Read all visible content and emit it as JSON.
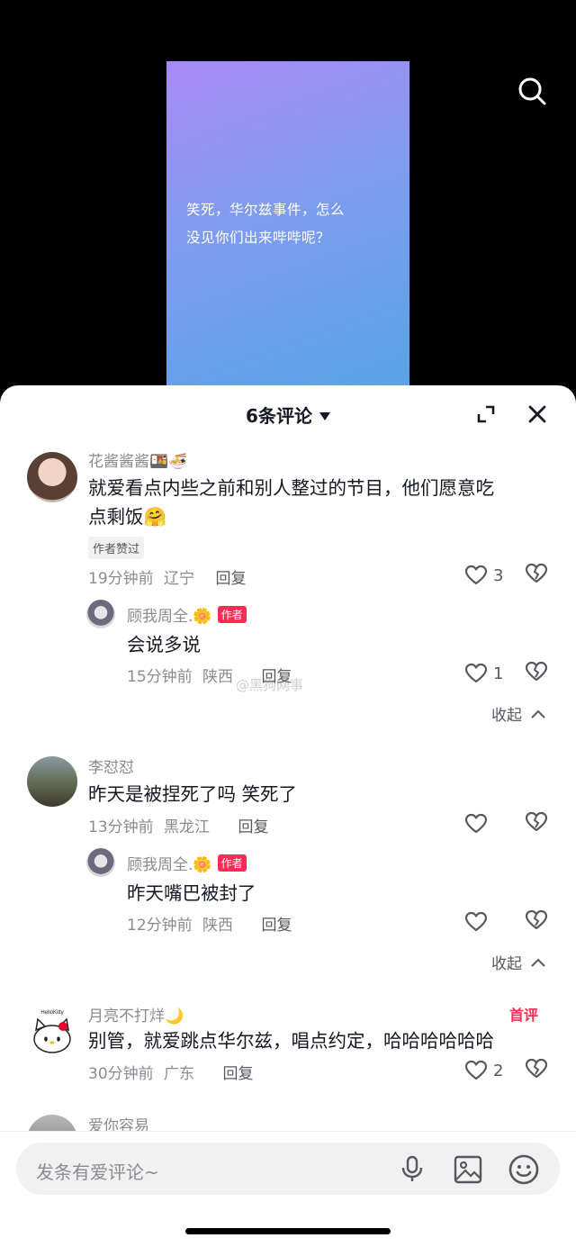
{
  "video": {
    "caption_line1": "笑死，华尔兹事件，怎么",
    "caption_line2": "没见你们出来哔哔呢？"
  },
  "icons": {
    "search": "search-icon",
    "expand": "expand-icon",
    "close": "close-icon",
    "like": "heart-icon",
    "dislike": "broken-heart-icon",
    "mic": "microphone-icon",
    "image": "image-icon",
    "emoji": "emoji-icon"
  },
  "header": {
    "count_label": "6条评论"
  },
  "comments": [
    {
      "name": "花酱酱酱🍱🍜",
      "text_line1": "就爱看点内些之前和别人整过的节目，他们愿意吃",
      "text_line2": "点剩饭🤗",
      "badge": "作者赞过",
      "time": "19分钟前",
      "location": "辽宁",
      "reply": "回复",
      "likes": "3",
      "replies": [
        {
          "name": "顾我周全.🌼",
          "author_tag": "作者",
          "text": "会说多说",
          "time": "15分钟前",
          "location": "陕西",
          "reply": "回复",
          "likes": "1"
        }
      ],
      "collapse": "收起"
    },
    {
      "name": "李怼怼",
      "text_line1": "昨天是被捏死了吗 笑死了",
      "time": "13分钟前",
      "location": "黑龙江",
      "reply": "回复",
      "likes": "",
      "replies": [
        {
          "name": "顾我周全.🌼",
          "author_tag": "作者",
          "text": "昨天嘴巴被封了",
          "time": "12分钟前",
          "location": "陕西",
          "reply": "回复",
          "likes": ""
        }
      ],
      "collapse": "收起"
    },
    {
      "name": "月亮不打烊🌙",
      "first_tag": "首评",
      "text_line1": "别管，就爱跳点华尔兹，唱点约定，哈哈哈哈哈哈",
      "time": "30分钟前",
      "location": "广东",
      "reply": "回复",
      "likes": "2"
    },
    {
      "name": "爱你容易"
    }
  ],
  "watermark": "@黑狗网事",
  "input": {
    "placeholder": "发条有爱评论~"
  }
}
